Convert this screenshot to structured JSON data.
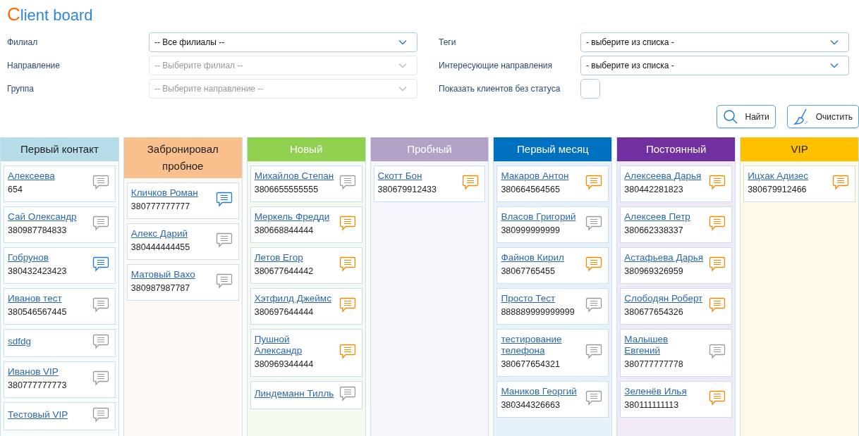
{
  "title": {
    "initial": "C",
    "rest": "lient board"
  },
  "filters": {
    "left": [
      {
        "label": "Филиал",
        "value": "-- Все филиалы --",
        "disabled": false
      },
      {
        "label": "Направление",
        "value": "-- Выберите филиал --",
        "disabled": true
      },
      {
        "label": "Группа",
        "value": "-- Выберите направление --",
        "disabled": true
      }
    ],
    "right": [
      {
        "kind": "select",
        "label": "Теги",
        "value": "- выберите из списка -",
        "disabled": false
      },
      {
        "kind": "select",
        "label": "Интересующие направления",
        "value": "- выберите из списка -",
        "disabled": false
      },
      {
        "kind": "checkbox",
        "label": "Показать клиентов без статуса",
        "checked": false
      }
    ]
  },
  "buttons": [
    {
      "kind": "search",
      "label": "Найти"
    },
    {
      "kind": "clear",
      "label": "Очистить"
    }
  ],
  "columns": [
    {
      "title": "Первый контакт",
      "color": "#b5dce8",
      "cards": [
        {
          "name": "Алексеева",
          "phone": "654",
          "color": "#9a9a9a"
        },
        {
          "name": "Сай Олександр",
          "phone": "380987784833",
          "color": "#9a9a9a"
        },
        {
          "name": "Гобрунов",
          "phone": "380432423423",
          "color": "#1e7ad6"
        },
        {
          "name": "Иванов тест",
          "phone": "380546567445",
          "color": "#9a9a9a"
        },
        {
          "name": "sdfdg",
          "color": "#9a9a9a"
        },
        {
          "name": "Иванов VIP",
          "phone": "380777777773",
          "color": "#9a9a9a"
        },
        {
          "name": "Тестовый VIP",
          "color": "#9a9a9a"
        }
      ]
    },
    {
      "title": "Забронировал пробное",
      "color": "#f9c08e",
      "cards": [
        {
          "name": "Кличков Роман",
          "phone": "380777777777",
          "color": "#1e7ad6"
        },
        {
          "name": "Алекс Дарий",
          "phone": "380444444455",
          "color": "#9a9a9a"
        },
        {
          "name": "Матовый Вахо",
          "phone": "380987987787",
          "color": "#9a9a9a"
        }
      ]
    },
    {
      "title": "Новый",
      "color": "#92d050",
      "cards": [
        {
          "name": "Михайлов Степан",
          "phone": "3806655555555",
          "color": "#9a9a9a"
        },
        {
          "name": "Меркель Фредди",
          "phone": "380668844444",
          "color": "#f08a00"
        },
        {
          "name": "Летов Егор",
          "phone": "380677644442",
          "color": "#f08a00"
        },
        {
          "name": "Хэтфилд Джеймс",
          "phone": "380697644444",
          "color": "#f08a00"
        },
        {
          "name": "Пушной Александр",
          "phone": "380969344444",
          "color": "#f08a00"
        },
        {
          "name": "Линдеманн Тилль",
          "color": "#9a9a9a"
        }
      ]
    },
    {
      "title": "Пробный",
      "color": "#b2a2c8",
      "cards": [
        {
          "name": "Скотт Бон",
          "phone": "380679912433",
          "color": "#f08a00"
        }
      ]
    },
    {
      "title": "Первый месяц",
      "color": "#0070c0",
      "cards": [
        {
          "name": "Макаров Антон",
          "phone": "380664564565",
          "color": "#f08a00"
        },
        {
          "name": "Власов Григорий",
          "phone": "380999999999",
          "color": "#9a9a9a"
        },
        {
          "name": "Файнов Кирил",
          "phone": "38067765455",
          "color": "#f08a00"
        },
        {
          "name": "Просто Тест",
          "phone": "888889999999999",
          "color": "#9a9a9a"
        },
        {
          "name": "тестирование телефона",
          "phone": "380677654321",
          "color": "#9a9a9a"
        },
        {
          "name": "Маников Георгий",
          "phone": "380344326663",
          "color": "#9a9a9a"
        }
      ]
    },
    {
      "title": "Постоянный",
      "color": "#7030a0",
      "cards": [
        {
          "name": "Алексеева Дарья",
          "phone": "380442281823",
          "color": "#f08a00"
        },
        {
          "name": "Алексеев Петр",
          "phone": "380662338337",
          "color": "#f08a00"
        },
        {
          "name": "Астафьева Дарья",
          "phone": "380969326959",
          "color": "#f08a00"
        },
        {
          "name": "Слободян Роберт",
          "phone": "380677654326",
          "color": "#f08a00"
        },
        {
          "name": "Малышев Евгений",
          "phone": "380777777778",
          "color": "#9a9a9a"
        },
        {
          "name": "Зеленёв Илья",
          "phone": "380111111113",
          "color": "#f08a00"
        }
      ]
    },
    {
      "title": "VIP",
      "color": "#ffc000",
      "cards": [
        {
          "name": "Ицхак Адизес",
          "phone": "380679912466",
          "color": "#f08a00"
        }
      ]
    }
  ]
}
